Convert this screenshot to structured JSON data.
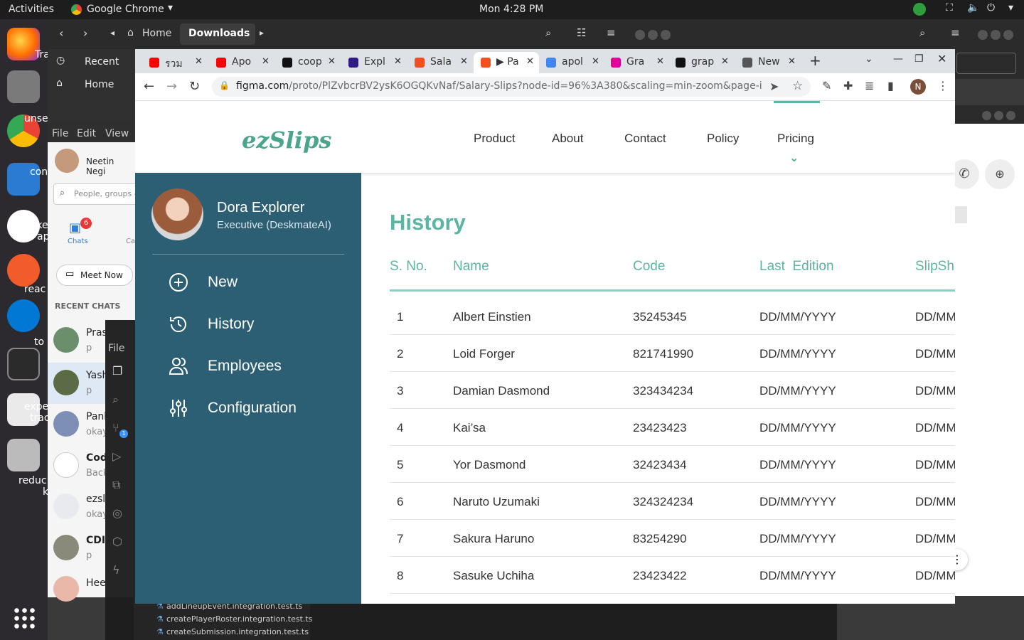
{
  "system_bar": {
    "activities": "Activities",
    "app_name": "Google Chrome",
    "clock": "Mon  4:28 PM"
  },
  "dock": {
    "labels": [
      "Tra",
      "unse",
      "con",
      "poke",
      "ap",
      "reac",
      "to",
      "expe",
      "trac",
      "reduc",
      "k"
    ]
  },
  "file_manager": {
    "path_home": "Home",
    "path_current": "Downloads",
    "sidebar": [
      {
        "label": "Recent",
        "icon": "clock-icon"
      },
      {
        "label": "Home",
        "icon": "home-icon"
      }
    ]
  },
  "teams": {
    "menu": [
      "File",
      "Edit",
      "View"
    ],
    "user_name": "Neetin Negi",
    "search_placeholder": "People, groups &",
    "chats_label": "Chats",
    "chats_badge": "6",
    "calls_label": "Ca",
    "meet_now": "Meet Now",
    "recent_chats": "RECENT CHATS",
    "chat_list": [
      {
        "name": "Pras",
        "preview": "p"
      },
      {
        "name": "Yash",
        "preview": "p"
      },
      {
        "name": "Pank",
        "preview": "okay"
      },
      {
        "name": "Cod",
        "preview": "Back"
      },
      {
        "name": "ezsli",
        "preview": "okay"
      },
      {
        "name": "CDI",
        "preview": "p"
      },
      {
        "name": "Hee",
        "preview": ""
      }
    ]
  },
  "vscode": {
    "file_label": "File",
    "badge": "1",
    "files": [
      "addLineupEvent.integration.test.ts",
      "createPlayerRoster.integration.test.ts",
      "createSubmission.integration.test.ts"
    ]
  },
  "chrome": {
    "tabs": [
      {
        "label": "รวม",
        "icon": "youtube-icon",
        "color": "#ff0000"
      },
      {
        "label": "Apo",
        "icon": "youtube-icon",
        "color": "#ff0000"
      },
      {
        "label": "coop",
        "icon": "github-icon",
        "color": "#111111"
      },
      {
        "label": "Expl",
        "icon": "apollo-icon",
        "color": "#311c87"
      },
      {
        "label": "Sala",
        "icon": "figma-icon",
        "color": "#f24e1e"
      },
      {
        "label": "▶ Pa",
        "icon": "figma-icon",
        "color": "#f24e1e",
        "active": true
      },
      {
        "label": "apol",
        "icon": "google-icon",
        "color": "#4285f4"
      },
      {
        "label": "Gra",
        "icon": "graphql-icon",
        "color": "#e10098"
      },
      {
        "label": "grap",
        "icon": "github-icon",
        "color": "#111111"
      },
      {
        "label": "New",
        "icon": "chrome-icon",
        "color": "#555555"
      }
    ],
    "url_domain": "figma.com",
    "url_path": "/proto/PlZvbcrBV2ysK6OGQKvNaf/Salary-Slips?node-id=96%3A380&scaling=min-zoom&page-id=0%3A1...",
    "profile_initial": "N"
  },
  "app": {
    "logo": "ezSlips",
    "nav": [
      "Product",
      "About",
      "Contact",
      "Policy",
      "Pricing"
    ],
    "active_nav": "Pricing",
    "profile": {
      "name": "Dora Explorer",
      "role": "Executive (DeskmateAI)"
    },
    "menu": [
      {
        "label": "New",
        "icon": "plus-circle-icon"
      },
      {
        "label": "History",
        "icon": "history-icon"
      },
      {
        "label": "Employees",
        "icon": "users-icon"
      },
      {
        "label": "Configuration",
        "icon": "sliders-icon"
      }
    ],
    "page_title": "History",
    "colors": {
      "sidebar": "#2d5f74",
      "accent": "#5bb5a2"
    },
    "table": {
      "headers": [
        "S. No.",
        "Name",
        "Code",
        "Last  Edition",
        "SlipSh"
      ],
      "rows": [
        [
          "1",
          "Albert Einstien",
          "35245345",
          "DD/MM/YYYY",
          "DD/MM"
        ],
        [
          "2",
          "Loid Forger",
          "821741990",
          "DD/MM/YYYY",
          "DD/MM"
        ],
        [
          "3",
          "Damian Dasmond",
          "323434234",
          "DD/MM/YYYY",
          "DD/MM"
        ],
        [
          "4",
          "Kai’sa",
          "23423423",
          "DD/MM/YYYY",
          "DD/MM"
        ],
        [
          "5",
          "Yor Dasmond",
          "32423434",
          "DD/MM/YYYY",
          "DD/MM"
        ],
        [
          "6",
          "Naruto Uzumaki",
          "324324234",
          "DD/MM/YYYY",
          "DD/MM"
        ],
        [
          "7",
          "Sakura Haruno",
          "83254290",
          "DD/MM/YYYY",
          "DD/MM"
        ],
        [
          "8",
          "Sasuke Uchiha",
          "23423422",
          "DD/MM/YYYY",
          "DD/MM"
        ]
      ]
    }
  }
}
